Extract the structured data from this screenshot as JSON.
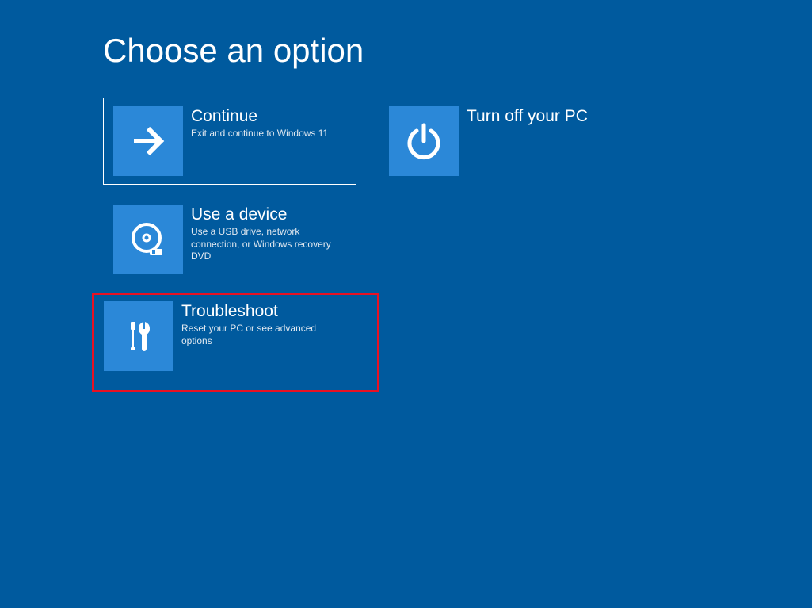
{
  "heading": "Choose an option",
  "options": {
    "continue": {
      "title": "Continue",
      "desc": "Exit and continue to Windows 11"
    },
    "turnoff": {
      "title": "Turn off your PC",
      "desc": ""
    },
    "use_device": {
      "title": "Use a device",
      "desc": "Use a USB drive, network connection, or Windows recovery DVD"
    },
    "troubleshoot": {
      "title": "Troubleshoot",
      "desc": "Reset your PC or see advanced options"
    }
  },
  "annotation": {
    "highlight_color": "#e81123",
    "highlighted_option": "troubleshoot"
  },
  "colors": {
    "background": "#005a9e",
    "tile_icon_bg": "#2b88d8"
  }
}
